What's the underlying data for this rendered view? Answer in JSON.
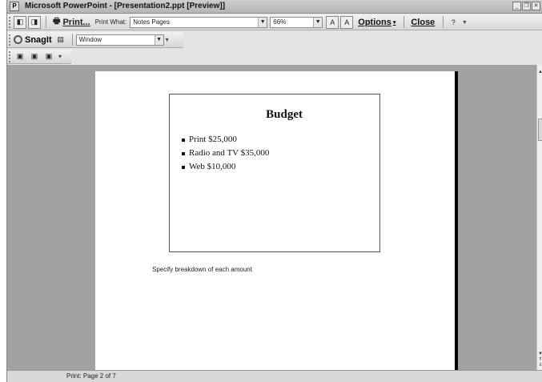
{
  "window": {
    "title": "Microsoft PowerPoint - [Presentation2.ppt [Preview]]",
    "app_icon": "powerpoint-icon"
  },
  "toolbar_preview": {
    "print_label": "Print...",
    "print_what_label": "Print What:",
    "print_what_value": "Notes Pages",
    "zoom_value": "66%",
    "options_label": "Options",
    "close_label": "Close"
  },
  "toolbar_snagit": {
    "brand_label": "SnagIt",
    "capture_mode_value": "Window"
  },
  "slide": {
    "title": "Budget",
    "bullets": [
      "Print $25,000",
      "Radio and TV $35,000",
      "Web $10,000"
    ]
  },
  "notes": {
    "text": "Specify breakdown of each amount"
  },
  "status": {
    "text": "Print: Page 2 of 7"
  },
  "colors": {
    "workspace": "#a2a2a2",
    "page": "#ffffff",
    "chrome": "#d6d6d6"
  }
}
